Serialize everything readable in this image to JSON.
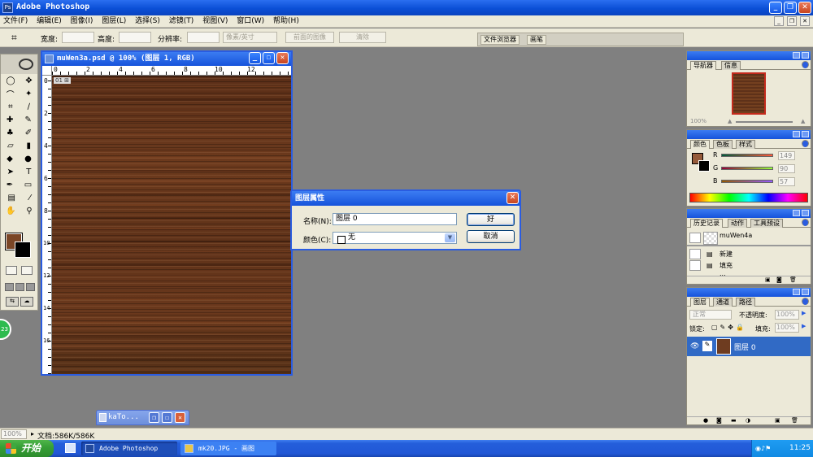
{
  "app": {
    "title": "Adobe Photoshop"
  },
  "menu": [
    "文件(F)",
    "编辑(E)",
    "图像(I)",
    "图层(L)",
    "选择(S)",
    "滤镜(T)",
    "视图(V)",
    "窗口(W)",
    "帮助(H)"
  ],
  "options": {
    "width_label": "宽度:",
    "height_label": "高度:",
    "resolution_label": "分辨率:",
    "unit_value": "像素/英寸",
    "front_image_label": "前面的图像",
    "clear_label": "清除"
  },
  "palette_well": {
    "file_browser": "文件浏览器",
    "brushes": "画笔"
  },
  "document": {
    "title": "muWen3a.psd @ 100% (图层 1, RGB)",
    "ruler_top": [
      "0",
      "2",
      "4",
      "6",
      "8",
      "10",
      "12"
    ],
    "ruler_left": [
      "0",
      "2",
      "4",
      "6",
      "8",
      "10",
      "12",
      "14",
      "16"
    ]
  },
  "dialog": {
    "title": "图层属性",
    "name_label": "名称(N):",
    "name_value": "图层 0",
    "color_label": "颜色(C):",
    "color_value": "无",
    "ok_label": "好",
    "cancel_label": "取消"
  },
  "minimized_doc": {
    "title": "kaTo..."
  },
  "status": {
    "zoom": "100%",
    "doc_info": "文档:586K/586K"
  },
  "navigator": {
    "tabs": [
      "导航器",
      "信息"
    ],
    "zoom": "100%"
  },
  "color_palette": {
    "tabs": [
      "颜色",
      "色板",
      "样式"
    ],
    "r_label": "R",
    "r_value": "149",
    "g_label": "G",
    "g_value": "90",
    "b_label": "B",
    "b_value": "57",
    "fg_color": "#955a39"
  },
  "history": {
    "tabs": [
      "历史记录",
      "动作",
      "工具预设"
    ],
    "snapshot": "muWen4a",
    "items": [
      "新建",
      "填充",
      "..."
    ]
  },
  "layers": {
    "tabs": [
      "图层",
      "通道",
      "路径"
    ],
    "blend_mode": "正常",
    "opacity_label": "不透明度:",
    "opacity_value": "100%",
    "lock_label": "锁定:",
    "fill_label": "填充:",
    "fill_value": "100%",
    "layer_name": "图层 0"
  },
  "taskbar": {
    "start": "开始",
    "tasks": [
      "Adobe Photoshop",
      "mk20.JPG - 画图"
    ],
    "clock": "11:25"
  }
}
